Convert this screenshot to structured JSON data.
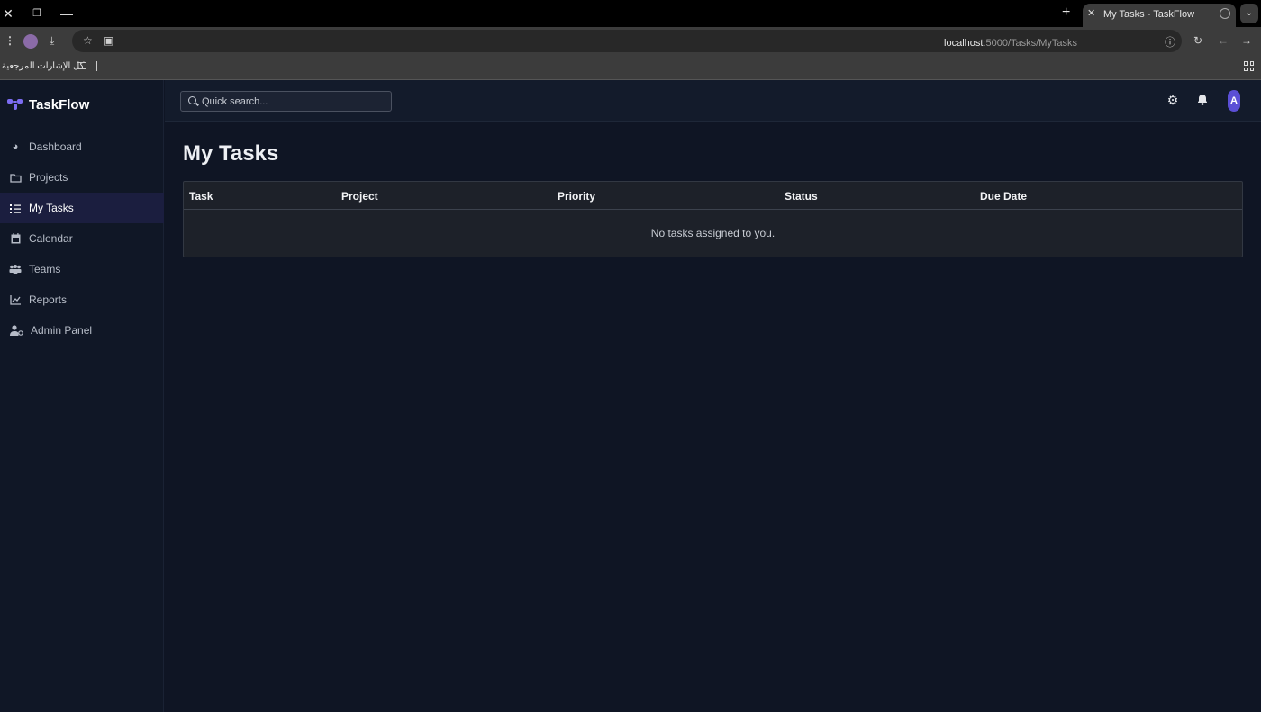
{
  "browser": {
    "tab_title": "My Tasks - TaskFlow",
    "url_host": "localhost",
    "url_path": ":5000/Tasks/MyTasks",
    "bookmarks_label": "كل الإشارات المرجعية"
  },
  "app": {
    "brand": "TaskFlow",
    "accent_color": "#7c6cf2"
  },
  "sidebar": {
    "items": [
      {
        "label": "Dashboard",
        "icon": "dashboard-icon",
        "active": false
      },
      {
        "label": "Projects",
        "icon": "folder-icon",
        "active": false
      },
      {
        "label": "My Tasks",
        "icon": "list-check-icon",
        "active": true
      },
      {
        "label": "Calendar",
        "icon": "calendar-icon",
        "active": false
      },
      {
        "label": "Teams",
        "icon": "users-icon",
        "active": false
      },
      {
        "label": "Reports",
        "icon": "chart-line-icon",
        "active": false
      },
      {
        "label": "Admin Panel",
        "icon": "user-cog-icon",
        "active": false
      }
    ]
  },
  "topbar": {
    "search_placeholder": "Quick search...",
    "avatar_initial": "A"
  },
  "main": {
    "title": "My Tasks",
    "table": {
      "columns": [
        "Task",
        "Project",
        "Priority",
        "Status",
        "Due Date"
      ],
      "rows": [],
      "empty_message": "No tasks assigned to you."
    }
  }
}
